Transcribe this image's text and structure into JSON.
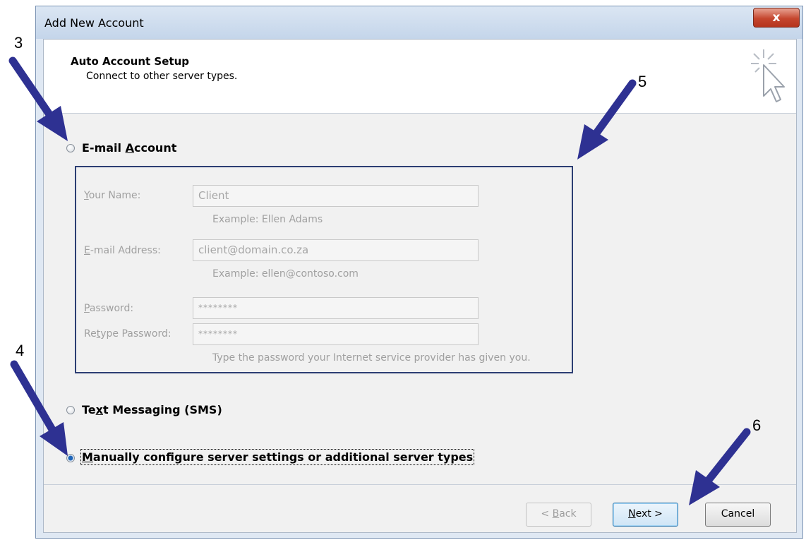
{
  "window": {
    "title": "Add New Account",
    "close_label": "x"
  },
  "header": {
    "title": "Auto Account Setup",
    "subtitle": "Connect to other server types."
  },
  "options": {
    "email_account": {
      "pre": "E-mail ",
      "accel": "A",
      "post": "ccount",
      "selected": false
    },
    "sms": {
      "pre": "Te",
      "accel": "x",
      "post": "t Messaging (SMS)",
      "selected": false
    },
    "manual": {
      "pre": "",
      "accel": "M",
      "post": "anually configure server settings or additional server types",
      "selected": true
    }
  },
  "form": {
    "name": {
      "label_accel": "Y",
      "label_rest": "our Name:",
      "value": "Client",
      "hint": "Example: Ellen Adams"
    },
    "email": {
      "label_accel": "E",
      "label_rest": "-mail Address:",
      "value": "client@domain.co.za",
      "hint": "Example: ellen@contoso.com"
    },
    "password": {
      "label_accel": "P",
      "label_rest": "assword:",
      "value": "********"
    },
    "retype": {
      "label_pre": "Re",
      "label_accel": "t",
      "label_rest": "ype Password:",
      "value": "********"
    },
    "password_hint": "Type the password your Internet service provider has given you."
  },
  "buttons": {
    "back": {
      "pre": "< ",
      "accel": "B",
      "post": "ack"
    },
    "next": {
      "accel": "N",
      "post": "ext >"
    },
    "cancel": "Cancel"
  },
  "annotations": {
    "step3": "3",
    "step4": "4",
    "step5": "5",
    "step6": "6"
  },
  "colors": {
    "arrow": "#2e3192",
    "group_border": "#2c3e73",
    "close_button": "#c5462e"
  }
}
